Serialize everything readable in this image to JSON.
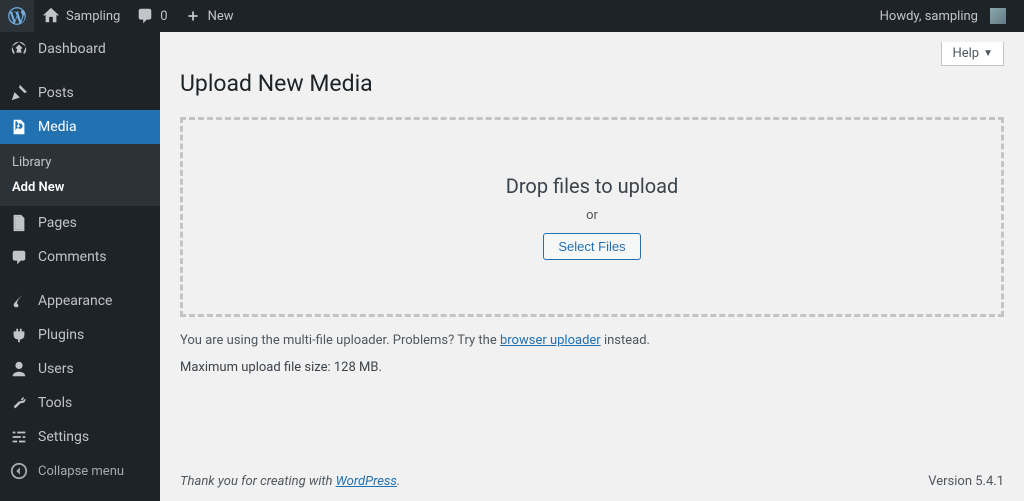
{
  "adminbar": {
    "site_name": "Sampling",
    "comments_count": "0",
    "new_label": "New",
    "howdy_prefix": "Howdy,",
    "user_name": "sampling"
  },
  "sidebar": {
    "items": [
      {
        "key": "dashboard",
        "label": "Dashboard"
      },
      {
        "key": "posts",
        "label": "Posts"
      },
      {
        "key": "media",
        "label": "Media"
      },
      {
        "key": "pages",
        "label": "Pages"
      },
      {
        "key": "comments",
        "label": "Comments"
      },
      {
        "key": "appearance",
        "label": "Appearance"
      },
      {
        "key": "plugins",
        "label": "Plugins"
      },
      {
        "key": "users",
        "label": "Users"
      },
      {
        "key": "tools",
        "label": "Tools"
      },
      {
        "key": "settings",
        "label": "Settings"
      }
    ],
    "media_submenu": {
      "library": "Library",
      "add_new": "Add New"
    },
    "collapse_label": "Collapse menu"
  },
  "page": {
    "help_label": "Help",
    "title": "Upload New Media",
    "drop_title": "Drop files to upload",
    "drop_or": "or",
    "select_btn": "Select Files",
    "uploader_note_pre": "You are using the multi-file uploader. Problems? Try the ",
    "uploader_note_link": "browser uploader",
    "uploader_note_post": " instead.",
    "max_size": "Maximum upload file size: 128 MB."
  },
  "footer": {
    "thank_pre": "Thank you for creating with ",
    "thank_link": "WordPress",
    "thank_post": ".",
    "version": "Version 5.4.1"
  }
}
